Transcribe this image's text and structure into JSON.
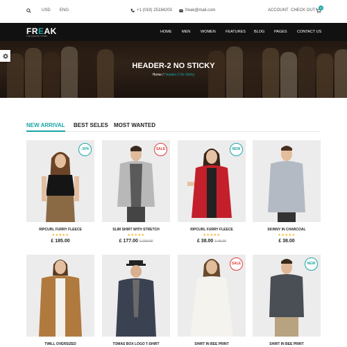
{
  "topbar": {
    "currency": "USD",
    "language": "ENG",
    "phone": "+1 (019) 25184203",
    "email": "freak@mail.com",
    "account": "ACCOUNT",
    "checkout": "CHECK OUT",
    "cart_count": "0",
    "icons": [
      "search-icon",
      "phone-icon",
      "mail-icon",
      "cart-icon"
    ]
  },
  "nav": {
    "logo_main": "FR",
    "logo_accent": "E",
    "logo_rest": "AK",
    "logo_tagline": "THE FASHION STORE",
    "items": [
      "HOME",
      "MEN",
      "WOMEN",
      "FEATURES",
      "BLOG",
      "PAGES",
      "CONTACT US"
    ]
  },
  "hero": {
    "title": "HEADER-2 NO STICKY",
    "breadcrumb_home": "Home",
    "breadcrumb_sep": "/",
    "breadcrumb_current": "Header-2 No Sticky"
  },
  "tabs": [
    "NEW ARRIVAL",
    "BEST SELES",
    "MOST WANTED"
  ],
  "colors": {
    "accent": "#1aa5a5",
    "sale": "#e23c3c",
    "star": "#f2b01e",
    "nav_bg": "#111111"
  },
  "products": [
    {
      "name": "RIPCURL FURRY FLEECE",
      "price": "£ 185.00",
      "old_price": "",
      "badge": "-30%",
      "badge_kind": "teal",
      "stars": "★★★★★"
    },
    {
      "name": "SLIM SHIRT WITH STRETCH",
      "price": "£ 177.00",
      "old_price": "£ 200.00",
      "badge": "SALE",
      "badge_kind": "red",
      "stars": "★★★★★"
    },
    {
      "name": "RIPCURL FURRY FLEECE",
      "price": "£ 38.00",
      "old_price": "£ 45.00",
      "badge": "NEW",
      "badge_kind": "teal",
      "stars": "★★★★★"
    },
    {
      "name": "SKINNY IN CHARCOAL",
      "price": "£ 38.00",
      "old_price": "",
      "badge": "",
      "badge_kind": "",
      "stars": "★★★★★"
    },
    {
      "name": "TWILL OVERSIZED",
      "price": "",
      "old_price": "",
      "badge": "",
      "badge_kind": "",
      "stars": ""
    },
    {
      "name": "TOMAS BOX LOGO T-SHIRT",
      "price": "",
      "old_price": "",
      "badge": "",
      "badge_kind": "",
      "stars": ""
    },
    {
      "name": "SHIRT IN BEE PRINT",
      "price": "",
      "old_price": "",
      "badge": "SALE",
      "badge_kind": "red",
      "stars": ""
    },
    {
      "name": "SHIRT IN BEE PRINT",
      "price": "",
      "old_price": "",
      "badge": "NEW",
      "badge_kind": "teal",
      "stars": ""
    }
  ]
}
